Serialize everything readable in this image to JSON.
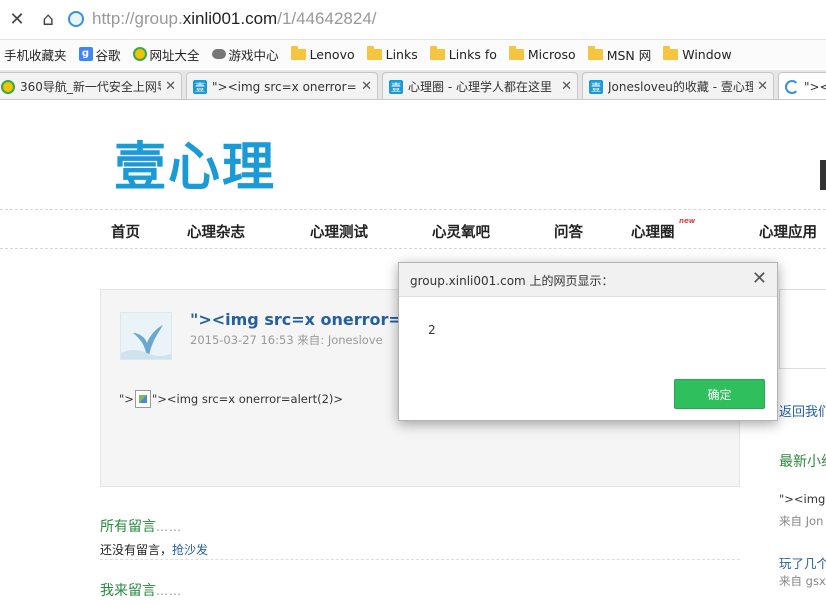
{
  "browser": {
    "url_prefix": "http://group.",
    "url_domain": "xinli001.com",
    "url_path": "/1/44642824/",
    "bookmarks": [
      {
        "label": "手机收藏夹",
        "icon": "mobile-icon"
      },
      {
        "label": "谷歌",
        "icon": "google-icon"
      },
      {
        "label": "网址大全",
        "icon": "360-icon"
      },
      {
        "label": "游戏中心",
        "icon": "gamepad-icon"
      },
      {
        "label": "Lenovo",
        "icon": "folder-icon"
      },
      {
        "label": "Links",
        "icon": "folder-icon"
      },
      {
        "label": "Links fo",
        "icon": "folder-icon"
      },
      {
        "label": "Microso",
        "icon": "folder-icon"
      },
      {
        "label": "MSN 网",
        "icon": "folder-icon"
      },
      {
        "label": "Window",
        "icon": "folder-icon"
      }
    ],
    "tabs": [
      {
        "label": "360导航_新一代安全上网导",
        "icon": "360-icon"
      },
      {
        "label": "\"><img src=x onerror=",
        "icon": "xinli-icon"
      },
      {
        "label": "心理圈 - 心理学人都在这里",
        "icon": "xinli-icon"
      },
      {
        "label": "Jonesloveu的收藏 - 壹心理",
        "icon": "xinli-icon"
      },
      {
        "label": "\"><",
        "icon": "loading-icon"
      }
    ]
  },
  "site": {
    "logo": "壹心理",
    "nav": [
      "首页",
      "心理杂志",
      "心理测试",
      "心灵氧吧",
      "问答",
      "心理圈",
      "心理应用"
    ],
    "new_badge": "new"
  },
  "post": {
    "title": "\"><img src=x onerror=ale",
    "date": "2015-03-27 16:53",
    "from_label": "来自:",
    "author": "Joneslove",
    "body_prefix": "\">",
    "body_suffix": "\"><img src=x onerror=alert(2)>"
  },
  "comments": {
    "all_title": "所有留言",
    "dots": "……",
    "none_text": "还没有留言，",
    "sofa_link": "抢沙发",
    "my_title": "我来留言",
    "my_dots": "……"
  },
  "sidebar": {
    "back_link": "返回我们",
    "latest_title": "最新小组",
    "item1": "\"><img s",
    "item1_meta": "来自 Jon",
    "item2": "玩了几个",
    "item2_meta": "来自 gsx"
  },
  "dialog": {
    "title": "group.xinli001.com 上的网页显示：",
    "message": "2",
    "ok_label": "确定"
  },
  "colors": {
    "brand": "#1a9ad6",
    "link": "#245fa0",
    "green": "#2a8a3e",
    "ok_button": "#2fbf5d"
  }
}
